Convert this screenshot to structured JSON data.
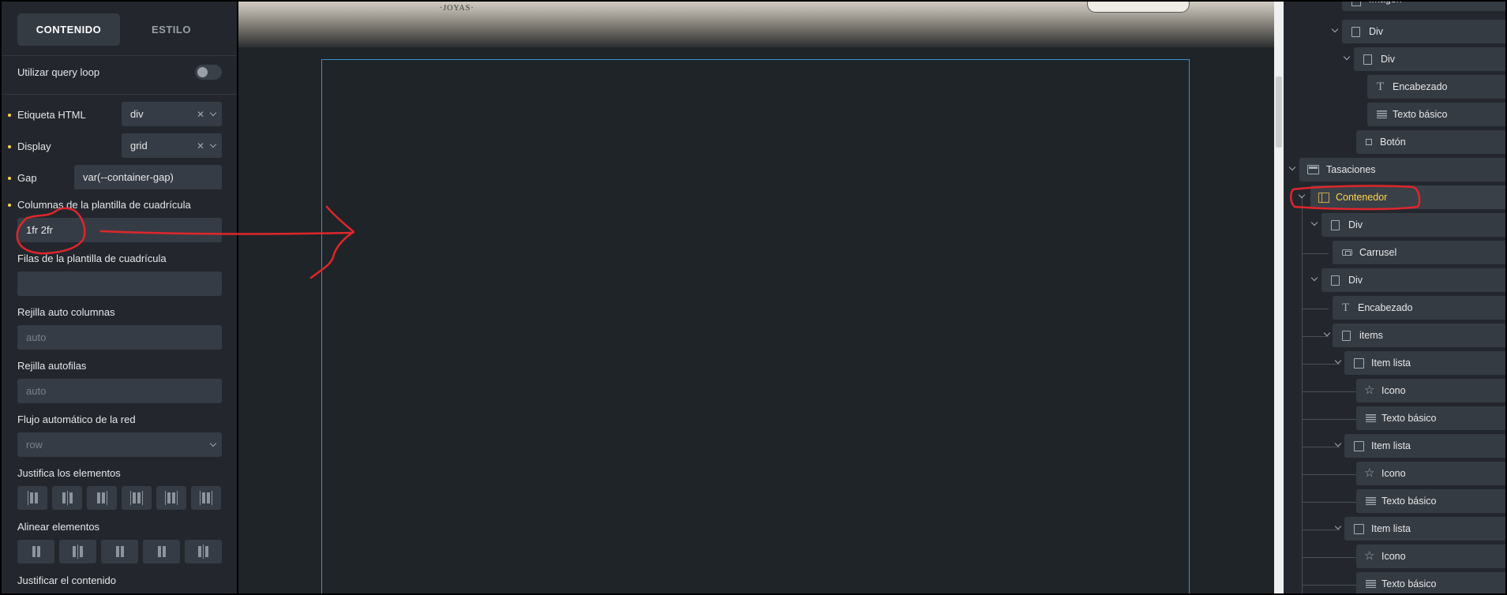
{
  "left_panel": {
    "tabs": {
      "content": "CONTENIDO",
      "style": "ESTILO"
    },
    "query_loop_label": "Utilizar query loop",
    "html_tag": {
      "label": "Etiqueta HTML",
      "value": "div"
    },
    "display": {
      "label": "Display",
      "value": "grid"
    },
    "gap": {
      "label": "Gap",
      "value": "var(--container-gap)"
    },
    "grid_columns": {
      "label": "Columnas de la plantilla de cuadrícula",
      "value": "1fr 2fr"
    },
    "grid_rows": {
      "label": "Filas de la plantilla de cuadrícula",
      "value": ""
    },
    "auto_columns": {
      "label": "Rejilla auto columnas",
      "placeholder": "auto"
    },
    "auto_rows": {
      "label": "Rejilla autofilas",
      "placeholder": "auto"
    },
    "auto_flow": {
      "label": "Flujo automático de la red",
      "value": "row"
    },
    "justify_items_label": "Justifica los elementos",
    "align_items_label": "Alinear elementos",
    "justify_content_label": "Justificar el contenido"
  },
  "canvas": {
    "brand": "·JOYAS·",
    "annotation_color": "#e0262b",
    "selection_color": "#3b8fd0"
  },
  "structure": {
    "items": [
      {
        "label": "Imagen"
      },
      {
        "label": "Div"
      },
      {
        "label": "Div"
      },
      {
        "label": "Encabezado"
      },
      {
        "label": "Texto básico"
      },
      {
        "label": "Botón"
      },
      {
        "label": "Tasaciones"
      },
      {
        "label": "Contenedor"
      },
      {
        "label": "Div"
      },
      {
        "label": "Carrusel"
      },
      {
        "label": "Div"
      },
      {
        "label": "Encabezado"
      },
      {
        "label": "items"
      },
      {
        "label": "Item lista"
      },
      {
        "label": "Icono"
      },
      {
        "label": "Texto básico"
      },
      {
        "label": "Item lista"
      },
      {
        "label": "Icono"
      },
      {
        "label": "Texto básico"
      },
      {
        "label": "Item lista"
      },
      {
        "label": "Icono"
      },
      {
        "label": "Texto básico"
      }
    ]
  }
}
